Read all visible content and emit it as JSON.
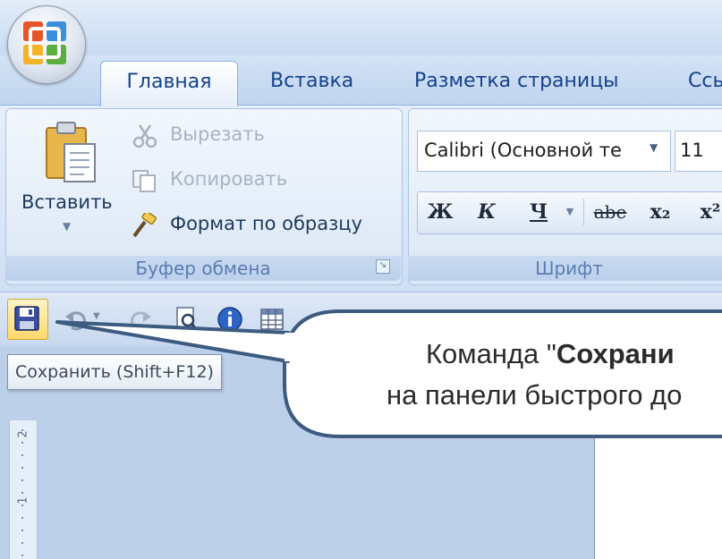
{
  "tabs": {
    "home": "Главная",
    "insert": "Вставка",
    "layout": "Разметка страницы",
    "references": "Ссы"
  },
  "clipboard": {
    "paste": "Вставить",
    "cut": "Вырезать",
    "copy": "Копировать",
    "format_painter": "Формат по образцу",
    "group_label": "Буфер обмена"
  },
  "font": {
    "name": "Calibri (Основной те",
    "size": "11",
    "bold": "Ж",
    "italic": "К",
    "underline": "Ч",
    "strikethrough": "abe",
    "subscript": "x₂",
    "superscript": "x²",
    "group_label": "Шрифт"
  },
  "quick_access": {
    "tooltip": "Сохранить (Shift+F12)"
  },
  "ruler": {
    "marks": [
      "2",
      "1"
    ]
  },
  "callout": {
    "line1_prefix": "Команда \"",
    "line1_bold": "Сохрани",
    "line2": "на панели быстрого до"
  },
  "colors": {
    "tab_text": "#15428b",
    "group_label": "#5a7db0",
    "highlight": "#ffd86b",
    "callout_border": "#3d5a80"
  }
}
